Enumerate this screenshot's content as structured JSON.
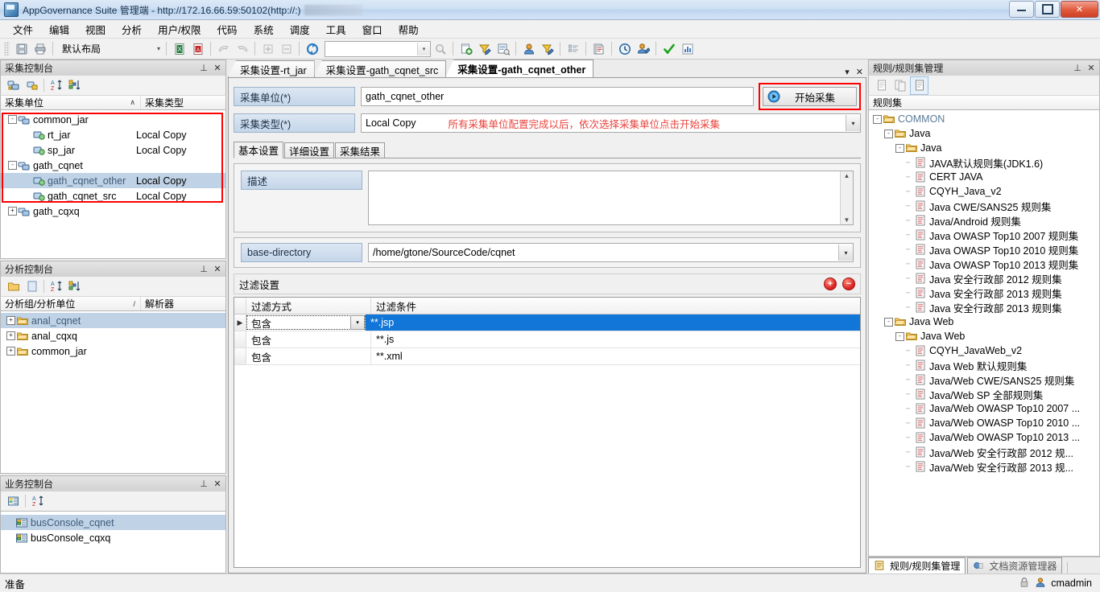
{
  "window": {
    "title": "AppGovernance Suite 管理端 - http://172.16.66.59:50102(http://:)",
    "minimize": "—",
    "maximize": "□",
    "close": "✕"
  },
  "menubar": {
    "items": [
      "文件",
      "编辑",
      "视图",
      "分析",
      "用户/权限",
      "代码",
      "系统",
      "调度",
      "工具",
      "窗口",
      "帮助"
    ]
  },
  "toolbar": {
    "layout_label": "默认布局",
    "layout_arrow": "▾",
    "combo_arrow": "▾",
    "icons": [
      "save-icon",
      "print-icon",
      "excel-export-icon",
      "pdf-export-icon",
      "import-icon",
      "export-icon",
      "expand-icon",
      "collapse-icon",
      "refresh-icon",
      "search-icon",
      "add-doc-icon",
      "filter-edit-icon",
      "report-icon",
      "user-icon",
      "user-edit-icon",
      "list-icon",
      "doc-icon",
      "clock-icon",
      "user-config-icon",
      "check-icon",
      "chart-icon"
    ]
  },
  "gather_console": {
    "title": "采集控制台",
    "pin": "⊥",
    "close": "✕",
    "tool_icons": [
      "new-unit-icon",
      "new-group-icon",
      "sort-az-icon",
      "sort-group-icon"
    ],
    "columns": [
      "采集单位",
      "采集类型"
    ],
    "sort_marker": "∧",
    "rows": [
      {
        "label": "common_jar",
        "type": "",
        "level": 0,
        "expander": "-",
        "icon": "group-icon",
        "selected": false
      },
      {
        "label": "rt_jar",
        "type": "Local Copy",
        "level": 1,
        "expander": "",
        "icon": "unit-icon",
        "selected": false
      },
      {
        "label": "sp_jar",
        "type": "Local Copy",
        "level": 1,
        "expander": "",
        "icon": "unit-icon",
        "selected": false
      },
      {
        "label": "gath_cqnet",
        "type": "",
        "level": 0,
        "expander": "-",
        "icon": "group-icon",
        "selected": false
      },
      {
        "label": "gath_cqnet_other",
        "type": "Local Copy",
        "level": 1,
        "expander": "",
        "icon": "unit-icon",
        "selected": true
      },
      {
        "label": "gath_cqnet_src",
        "type": "Local Copy",
        "level": 1,
        "expander": "",
        "icon": "unit-icon",
        "selected": false
      },
      {
        "label": "gath_cqxq",
        "type": "",
        "level": 0,
        "expander": "+",
        "icon": "group-icon",
        "selected": false
      }
    ]
  },
  "analysis_console": {
    "title": "分析控制台",
    "pin": "⊥",
    "close": "✕",
    "tool_icons": [
      "folder-icon",
      "page-icon",
      "sort-az-icon",
      "sort-group-icon"
    ],
    "columns": [
      "分析组/分析单位",
      "解析器"
    ],
    "sort_marker": "/",
    "rows": [
      {
        "label": "anal_cqnet",
        "expander": "+",
        "selected": true
      },
      {
        "label": "anal_cqxq",
        "expander": "+",
        "selected": false
      },
      {
        "label": "common_jar",
        "expander": "+",
        "selected": false
      }
    ]
  },
  "business_console": {
    "title": "业务控制台",
    "pin": "⊥",
    "close": "✕",
    "tool_icons": [
      "console-icon",
      "sort-az-icon"
    ],
    "rows": [
      {
        "label": "busConsole_cqnet",
        "selected": true
      },
      {
        "label": "busConsole_cqxq",
        "selected": false
      }
    ]
  },
  "editor": {
    "tabs": [
      {
        "label": "采集设置-rt_jar",
        "active": false
      },
      {
        "label": "采集设置-gath_cqnet_src",
        "active": false
      },
      {
        "label": "采集设置-gath_cqnet_other",
        "active": true
      }
    ],
    "tab_menu_arrow": "▾",
    "tab_close": "✕",
    "fields": {
      "unit_label": "采集单位(*)",
      "unit_value": "gath_cqnet_other",
      "type_label": "采集类型(*)",
      "type_value": "Local Copy",
      "type_arrow": "▾"
    },
    "annotation": "所有采集单位配置完成以后，依次选择采集单位点击开始采集",
    "start_button": {
      "label": "开始采集",
      "icon": "play-icon"
    },
    "inner_tabs": [
      {
        "label": "基本设置",
        "active": true
      },
      {
        "label": "详细设置",
        "active": false
      },
      {
        "label": "采集结果",
        "active": false
      }
    ],
    "desc_label": "描述",
    "desc_value": "",
    "scroll_up": "▲",
    "scroll_down": "▼",
    "basedir_label": "base-directory",
    "basedir_value": "/home/gtone/SourceCode/cqnet",
    "basedir_arrow": "▾",
    "filter_section_title": "过滤设置",
    "filter_add": "+",
    "filter_remove": "−",
    "filter_columns": [
      "过滤方式",
      "过滤条件"
    ],
    "row_marker": "▶",
    "filter_rows": [
      {
        "mode": "包含",
        "condition": "**.jsp",
        "selected": true,
        "editing": true,
        "arrow": "▾"
      },
      {
        "mode": "包含",
        "condition": "**.js",
        "selected": false,
        "editing": false,
        "arrow": ""
      },
      {
        "mode": "包含",
        "condition": "**.xml",
        "selected": false,
        "editing": false,
        "arrow": ""
      }
    ]
  },
  "rules_panel": {
    "title": "规则/规则集管理",
    "pin": "⊥",
    "close": "✕",
    "tool_icons": [
      "rule-icon",
      "ruleset-icon",
      "rule-edit-icon"
    ],
    "column": "规则集",
    "tree": [
      {
        "label": "COMMON",
        "indent": 0,
        "expander": "-",
        "icon": "folder-open-icon",
        "muted": true
      },
      {
        "label": "Java",
        "indent": 1,
        "expander": "-",
        "icon": "folder-open-icon",
        "muted": false
      },
      {
        "label": "Java",
        "indent": 2,
        "expander": "-",
        "icon": "folder-open-icon",
        "muted": false
      },
      {
        "label": "JAVA默认规则集(JDK1.6)",
        "indent": 3,
        "expander": "",
        "icon": "ruleset-file-icon",
        "muted": false
      },
      {
        "label": "CERT JAVA",
        "indent": 3,
        "expander": "",
        "icon": "ruleset-file-icon",
        "muted": false
      },
      {
        "label": "CQYH_Java_v2",
        "indent": 3,
        "expander": "",
        "icon": "ruleset-file-icon",
        "muted": false
      },
      {
        "label": "Java CWE/SANS25 规则集",
        "indent": 3,
        "expander": "",
        "icon": "ruleset-file-icon",
        "muted": false
      },
      {
        "label": "Java/Android 规则集",
        "indent": 3,
        "expander": "",
        "icon": "ruleset-file-icon",
        "muted": false
      },
      {
        "label": "Java OWASP Top10 2007 规则集",
        "indent": 3,
        "expander": "",
        "icon": "ruleset-file-icon",
        "muted": false
      },
      {
        "label": "Java OWASP Top10 2010 规则集",
        "indent": 3,
        "expander": "",
        "icon": "ruleset-file-icon",
        "muted": false
      },
      {
        "label": "Java OWASP Top10 2013 规则集",
        "indent": 3,
        "expander": "",
        "icon": "ruleset-file-icon",
        "muted": false
      },
      {
        "label": "Java 安全行政部 2012 规则集",
        "indent": 3,
        "expander": "",
        "icon": "ruleset-file-icon",
        "muted": false
      },
      {
        "label": "Java 安全行政部 2013 规则集",
        "indent": 3,
        "expander": "",
        "icon": "ruleset-file-icon",
        "muted": false
      },
      {
        "label": "Java 安全行政部 2013 规则集",
        "indent": 3,
        "expander": "",
        "icon": "ruleset-file-icon",
        "muted": false
      },
      {
        "label": "Java Web",
        "indent": 1,
        "expander": "-",
        "icon": "folder-open-icon",
        "muted": false
      },
      {
        "label": "Java Web",
        "indent": 2,
        "expander": "-",
        "icon": "folder-open-icon",
        "muted": false
      },
      {
        "label": "CQYH_JavaWeb_v2",
        "indent": 3,
        "expander": "",
        "icon": "ruleset-file-icon",
        "muted": false
      },
      {
        "label": "Java Web 默认规则集",
        "indent": 3,
        "expander": "",
        "icon": "ruleset-file-icon",
        "muted": false
      },
      {
        "label": "Java/Web CWE/SANS25 规则集",
        "indent": 3,
        "expander": "",
        "icon": "ruleset-file-icon",
        "muted": false
      },
      {
        "label": "Java/Web SP 全部规则集",
        "indent": 3,
        "expander": "",
        "icon": "ruleset-file-icon",
        "muted": false
      },
      {
        "label": "Java/Web OWASP Top10 2007 ...",
        "indent": 3,
        "expander": "",
        "icon": "ruleset-file-icon",
        "muted": false
      },
      {
        "label": "Java/Web OWASP Top10 2010 ...",
        "indent": 3,
        "expander": "",
        "icon": "ruleset-file-icon",
        "muted": false
      },
      {
        "label": "Java/Web OWASP Top10 2013 ...",
        "indent": 3,
        "expander": "",
        "icon": "ruleset-file-icon",
        "muted": false
      },
      {
        "label": "Java/Web 安全行政部 2012 规...",
        "indent": 3,
        "expander": "",
        "icon": "ruleset-file-icon",
        "muted": false
      },
      {
        "label": "Java/Web 安全行政部 2013 规...",
        "indent": 3,
        "expander": "",
        "icon": "ruleset-file-icon",
        "muted": false
      }
    ],
    "bottom_tabs": [
      {
        "label": "规则/规则集管理",
        "active": true,
        "icon": "rules-tab-icon"
      },
      {
        "label": "文档资源管理器",
        "active": false,
        "icon": "docs-tab-icon"
      }
    ]
  },
  "statusbar": {
    "text": "准备",
    "user": "cmadmin",
    "lock_icon": "lock-icon",
    "user_icon": "user-icon"
  }
}
